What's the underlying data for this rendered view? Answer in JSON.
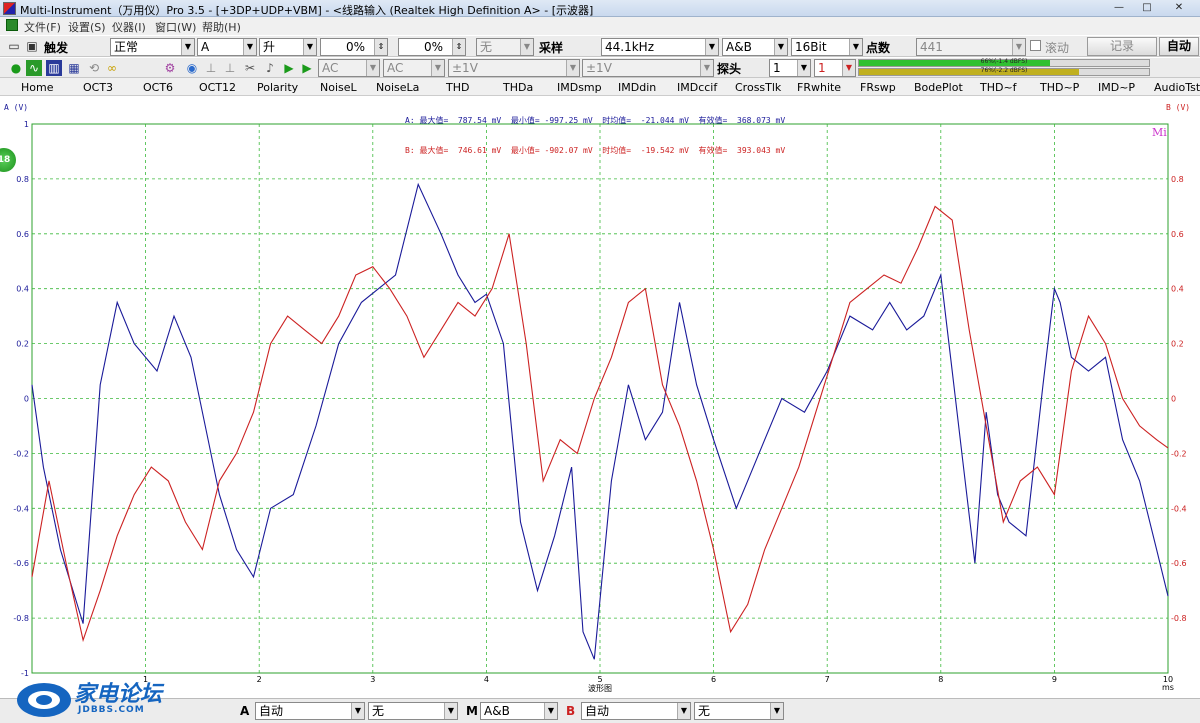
{
  "window": {
    "title": "Multi-Instrument（万用仪）Pro 3.5  -  [+3DP+UDP+VBM]  -  <线路输入 (Realtek High Definition A> - [示波器]",
    "minimize": "—",
    "maximize": "□",
    "close": "✕"
  },
  "menu": [
    "文件(F)",
    "设置(S)",
    "仪器(I)",
    "窗口(W)",
    "帮助(H)"
  ],
  "toolbar1": {
    "trigger_label": "触发",
    "trigger_mode": "正常",
    "trigger_source": "A",
    "trigger_edge": "升",
    "level_value": "0%",
    "pretrigger_value": "0%",
    "filter": "无",
    "sample_label": "采样",
    "sample_rate": "44.1kHz",
    "channels": "A&B",
    "bit_depth": "16Bit",
    "points_label": "点数",
    "points": "441",
    "scroll_label": "滚动",
    "record_button": "记录",
    "auto_button": "自动"
  },
  "toolbar2": {
    "coupling_a": "AC",
    "coupling_b": "AC",
    "range_a": "±1V",
    "range_b": "±1V",
    "probe_label": "探头",
    "probe_a": "1",
    "probe_b": "1",
    "level_a_text": "66%(-1.4 dBFS)",
    "level_b_text": "76%(-2.2 dBFS)",
    "level_a": 0.66,
    "level_b": 0.76
  },
  "tabs": [
    "Home",
    "OCT3",
    "OCT6",
    "OCT12",
    "Polarity",
    "NoiseL",
    "NoiseLa",
    "THD",
    "THDa",
    "IMDsmp",
    "IMDdin",
    "IMDccif",
    "CrossTlk",
    "FRwhite",
    "FRswp",
    "BodePlot",
    "THD~f",
    "THD~P",
    "IMD~P",
    "AudioTst"
  ],
  "readout": {
    "a": "A: 最大值=  787.54 mV  最小值= -997.25 mV  时均值=  -21.044 mV  有效值=  368.073 mV",
    "b": "B: 最大值=  746.61 mV  最小值= -902.07 mV  时均值=  -19.542 mV  有效值=  393.043 mV"
  },
  "badge": "18",
  "mi_label": "Mi",
  "chart_data": {
    "type": "line",
    "ylabel_left": "A (V)",
    "ylabel_right": "B (V)",
    "xlabel": "波形图",
    "x_unit": "ms",
    "ylim": [
      -1,
      1
    ],
    "xlim": [
      0,
      10
    ],
    "xticks": [
      "1",
      "2",
      "3",
      "4",
      "5",
      "6",
      "7",
      "8",
      "9",
      "10"
    ],
    "yticks_left": [
      "1",
      "0.8",
      "0.6",
      "0.4",
      "0.2",
      "0",
      "-0.2",
      "-0.4",
      "-0.6",
      "-0.8",
      "-1"
    ],
    "yticks_right": [
      "0.8",
      "0.6",
      "0.4",
      "0.2",
      "0",
      "-0.2",
      "-0.4",
      "-0.6",
      "-0.8"
    ],
    "grid": true,
    "series": [
      {
        "name": "A",
        "color": "#1a1a99",
        "x": [
          0,
          0.1,
          0.25,
          0.45,
          0.6,
          0.75,
          0.9,
          1.1,
          1.25,
          1.4,
          1.55,
          1.65,
          1.8,
          1.95,
          2.1,
          2.3,
          2.5,
          2.7,
          2.9,
          3.05,
          3.2,
          3.4,
          3.6,
          3.75,
          3.9,
          4.0,
          4.15,
          4.3,
          4.45,
          4.6,
          4.75,
          4.85,
          4.95,
          5.1,
          5.25,
          5.4,
          5.55,
          5.7,
          5.85,
          6.0,
          6.2,
          6.4,
          6.6,
          6.8,
          7.0,
          7.2,
          7.4,
          7.55,
          7.7,
          7.85,
          8.0,
          8.1,
          8.2,
          8.3,
          8.4,
          8.5,
          8.6,
          8.75,
          8.9,
          9.0,
          9.05,
          9.15,
          9.3,
          9.45,
          9.6,
          9.75,
          9.9,
          10.0
        ],
        "y": [
          0.05,
          -0.25,
          -0.55,
          -0.82,
          0.05,
          0.35,
          0.2,
          0.1,
          0.3,
          0.15,
          -0.15,
          -0.35,
          -0.55,
          -0.65,
          -0.4,
          -0.35,
          -0.1,
          0.2,
          0.35,
          0.4,
          0.45,
          0.78,
          0.6,
          0.45,
          0.35,
          0.38,
          0.2,
          -0.45,
          -0.7,
          -0.5,
          -0.25,
          -0.85,
          -0.95,
          -0.3,
          0.05,
          -0.15,
          -0.05,
          0.35,
          0.05,
          -0.15,
          -0.4,
          -0.2,
          0.0,
          -0.05,
          0.1,
          0.3,
          0.25,
          0.35,
          0.25,
          0.3,
          0.45,
          0.1,
          -0.25,
          -0.6,
          -0.05,
          -0.35,
          -0.45,
          -0.5,
          0.05,
          0.4,
          0.35,
          0.15,
          0.1,
          0.15,
          -0.15,
          -0.3,
          -0.55,
          -0.72
        ]
      },
      {
        "name": "B",
        "color": "#cc2222",
        "x": [
          0,
          0.15,
          0.3,
          0.45,
          0.6,
          0.75,
          0.9,
          1.05,
          1.2,
          1.35,
          1.5,
          1.65,
          1.8,
          1.95,
          2.1,
          2.25,
          2.4,
          2.55,
          2.7,
          2.85,
          3.0,
          3.15,
          3.3,
          3.45,
          3.6,
          3.75,
          3.9,
          4.05,
          4.2,
          4.35,
          4.5,
          4.65,
          4.8,
          4.95,
          5.1,
          5.25,
          5.4,
          5.55,
          5.7,
          5.85,
          6.0,
          6.15,
          6.3,
          6.45,
          6.6,
          6.75,
          6.9,
          7.05,
          7.2,
          7.35,
          7.5,
          7.65,
          7.8,
          7.95,
          8.1,
          8.25,
          8.4,
          8.55,
          8.7,
          8.85,
          9.0,
          9.15,
          9.3,
          9.45,
          9.6,
          9.75,
          9.9,
          10.0
        ],
        "y": [
          -0.65,
          -0.3,
          -0.6,
          -0.88,
          -0.7,
          -0.5,
          -0.35,
          -0.25,
          -0.3,
          -0.45,
          -0.55,
          -0.3,
          -0.2,
          -0.05,
          0.2,
          0.3,
          0.25,
          0.2,
          0.3,
          0.45,
          0.48,
          0.4,
          0.3,
          0.15,
          0.25,
          0.35,
          0.3,
          0.4,
          0.6,
          0.2,
          -0.3,
          -0.15,
          -0.2,
          0.0,
          0.15,
          0.35,
          0.4,
          0.05,
          -0.1,
          -0.3,
          -0.55,
          -0.85,
          -0.75,
          -0.55,
          -0.4,
          -0.25,
          -0.05,
          0.15,
          0.35,
          0.4,
          0.45,
          0.42,
          0.55,
          0.7,
          0.65,
          0.25,
          -0.1,
          -0.45,
          -0.3,
          -0.25,
          -0.35,
          0.1,
          0.3,
          0.2,
          0.0,
          -0.1,
          -0.15,
          -0.18
        ]
      }
    ]
  }
}
